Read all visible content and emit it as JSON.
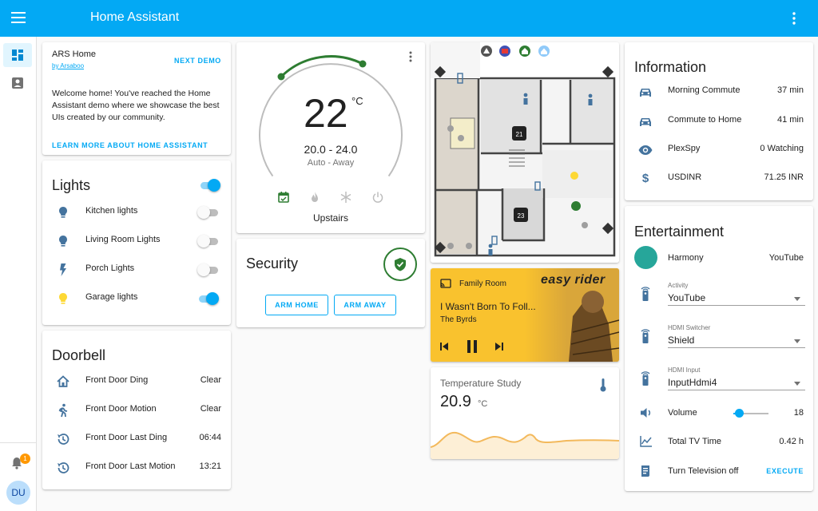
{
  "app": {
    "title": "Home Assistant"
  },
  "sidebar": {
    "notification_count": "1",
    "user_initials": "DU"
  },
  "welcome": {
    "title": "ARS Home",
    "author": "by Arsaboo",
    "next_demo": "NEXT DEMO",
    "text": "Welcome home! You've reached the Home Assistant demo where we showcase the best UIs created by our community.",
    "learn_more": "LEARN MORE ABOUT HOME ASSISTANT"
  },
  "lights": {
    "title": "Lights",
    "master_on": true,
    "items": [
      {
        "label": "Kitchen lights",
        "icon": "bulb-icon",
        "on": false
      },
      {
        "label": "Living Room Lights",
        "icon": "bulb-icon",
        "on": false
      },
      {
        "label": "Porch Lights",
        "icon": "flash-icon",
        "on": false
      },
      {
        "label": "Garage lights",
        "icon": "bulb-icon",
        "on": true
      }
    ]
  },
  "doorbell": {
    "title": "Doorbell",
    "items": [
      {
        "label": "Front Door Ding",
        "value": "Clear",
        "icon": "home-icon"
      },
      {
        "label": "Front Door Motion",
        "value": "Clear",
        "icon": "walk-icon"
      },
      {
        "label": "Front Door Last Ding",
        "value": "06:44",
        "icon": "history-icon"
      },
      {
        "label": "Front Door Last Motion",
        "value": "13:21",
        "icon": "history-icon"
      }
    ]
  },
  "thermostat": {
    "temperature": "22",
    "unit": "°C",
    "range": "20.0 - 24.0",
    "mode": "Auto - Away",
    "name": "Upstairs",
    "modes": [
      "calendar-icon",
      "fire-icon",
      "snowflake-icon",
      "power-icon"
    ]
  },
  "security": {
    "title": "Security",
    "arm_home": "ARM HOME",
    "arm_away": "ARM AWAY"
  },
  "floorplan": {
    "thermostat_1": "21",
    "thermostat_2": "23"
  },
  "media": {
    "source": "Family Room",
    "track": "I Wasn't Born To Foll...",
    "artist": "The Byrds",
    "album_art_text": "easy rider"
  },
  "temperature_study": {
    "title": "Temperature Study",
    "value": "20.9",
    "unit": "°C"
  },
  "information": {
    "title": "Information",
    "items": [
      {
        "label": "Morning Commute",
        "value": "37 min",
        "icon": "car-icon"
      },
      {
        "label": "Commute to Home",
        "value": "41 min",
        "icon": "car-icon"
      },
      {
        "label": "PlexSpy",
        "value": "0 Watching",
        "icon": "eye-icon"
      },
      {
        "label": "USDINR",
        "value": "71.25 INR",
        "icon": "dollar-icon"
      }
    ]
  },
  "entertainment": {
    "title": "Entertainment",
    "harmony_label": "Harmony",
    "harmony_value": "YouTube",
    "activity_label": "Activity",
    "activity_value": "YouTube",
    "hdmi_switcher_label": "HDMI Switcher",
    "hdmi_switcher_value": "Shield",
    "hdmi_input_label": "HDMI Input",
    "hdmi_input_value": "InputHdmi4",
    "volume_label": "Volume",
    "volume_value": "18",
    "volume_fraction": 0.18,
    "tv_time_label": "Total TV Time",
    "tv_time_value": "0.42 h",
    "tv_off_label": "Turn Television off",
    "execute": "EXECUTE"
  },
  "colors": {
    "primary": "#03a9f4",
    "accent": "#ff9800",
    "green": "#2e7d32",
    "icon": "#44739e"
  }
}
